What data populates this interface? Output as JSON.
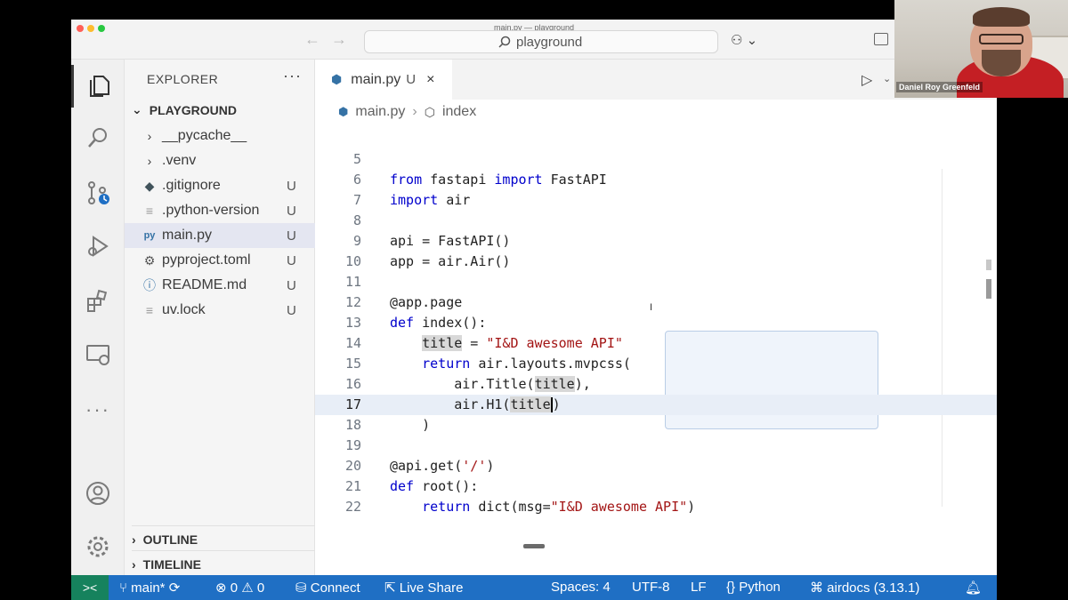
{
  "window": {
    "title": "main.py — playground",
    "search_text": "playground"
  },
  "activity_bar": {
    "items": [
      "explorer-icon",
      "search-icon",
      "source-control-icon",
      "run-debug-icon",
      "extensions-icon",
      "remote-explorer-icon",
      "more-icon",
      "accounts-icon",
      "settings-gear-icon"
    ]
  },
  "sidebar": {
    "title": "EXPLORER",
    "more": "···",
    "section": "PLAYGROUND",
    "items": [
      {
        "label": "__pycache__",
        "badge": "",
        "icon": "›"
      },
      {
        "label": ".venv",
        "badge": "",
        "icon": "›"
      },
      {
        "label": ".gitignore",
        "badge": "U",
        "icon": "◆"
      },
      {
        "label": ".python-version",
        "badge": "U",
        "icon": "≡"
      },
      {
        "label": "main.py",
        "badge": "U",
        "icon": "py"
      },
      {
        "label": "pyproject.toml",
        "badge": "U",
        "icon": "⚙"
      },
      {
        "label": "README.md",
        "badge": "U",
        "icon": "ⓘ"
      },
      {
        "label": "uv.lock",
        "badge": "U",
        "icon": "≡"
      }
    ],
    "outline": "OUTLINE",
    "timeline": "TIMELINE"
  },
  "editor": {
    "tab": {
      "label": "main.py",
      "badge": "U",
      "close": "×"
    },
    "breadcrumbs": {
      "file": "main.py",
      "symbol": "index"
    },
    "current_line": 17
  },
  "statusbar": {
    "branch": "main*",
    "errors": "0",
    "warnings": "0",
    "connect": "Connect",
    "live_share": "Live Share",
    "spaces": "Spaces: 4",
    "encoding": "UTF-8",
    "eol": "LF",
    "language": "Python",
    "interpreter": "airdocs (3.13.1)"
  },
  "video": {
    "name": "Daniel Roy Greenfeld"
  },
  "colors": {
    "statusbar": "#1f6fc4",
    "remote": "#16825d",
    "keyword": "#0000cc",
    "string": "#a31515"
  }
}
